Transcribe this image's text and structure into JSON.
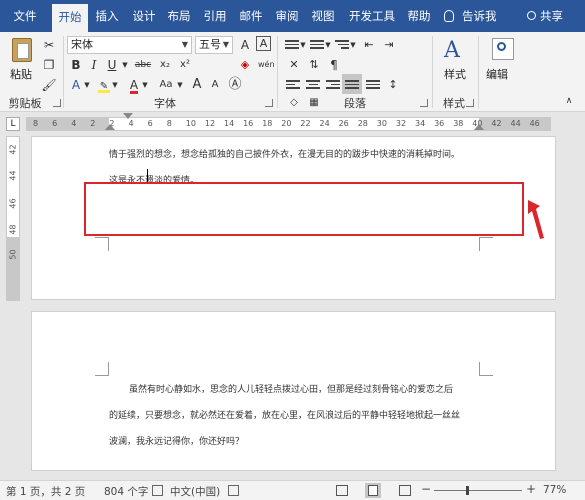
{
  "menu": {
    "tabs": [
      "文件",
      "开始",
      "插入",
      "设计",
      "布局",
      "引用",
      "邮件",
      "审阅",
      "视图",
      "开发工具",
      "帮助"
    ],
    "active": "开始",
    "tell_me": "告诉我",
    "share": "共享"
  },
  "ribbon": {
    "paste_label": "粘贴",
    "font_name": "宋体",
    "font_size": "五号",
    "groups": {
      "clipboard": "剪贴板",
      "font": "字体",
      "paragraph": "段落",
      "styles": "样式"
    },
    "styles_label": "样式",
    "edit_label": "编辑",
    "font_buttons": [
      "B",
      "I",
      "U",
      "abc",
      "x₂",
      "x²",
      "A",
      "A",
      "Aa",
      "A",
      "A"
    ],
    "grow_font": "A",
    "shrink_font": "A",
    "case": "Aa",
    "clear_format": "A",
    "wen": "wén",
    "a_box": "A"
  },
  "ruler": {
    "corner": "L",
    "ticks": [
      "8",
      "6",
      "4",
      "2",
      "2",
      "4",
      "6",
      "8",
      "10",
      "12",
      "14",
      "16",
      "18",
      "20",
      "22",
      "24",
      "26",
      "28",
      "30",
      "32",
      "34",
      "36",
      "38",
      "40",
      "42",
      "44",
      "46"
    ],
    "vticks": [
      "42",
      "44",
      "46",
      "48",
      "50"
    ]
  },
  "page1": {
    "lines": [
      "情于强烈的想念，想念给孤独的自己披件外衣，在漫无目的的跋步中快速的消耗掉时间。",
      "这是永不遗淡的爱情。"
    ]
  },
  "page2": {
    "lines": [
      "虽然有时心静如水，思念的人儿轻轻点拨过心田，但那是经过刻骨铭心的爱恋之后",
      "的延续，只要想念，就必然还在爱着，放在心里，在风浪过后的平静中轻轻地掀起一丝丝",
      "波澜，我永远记得你，你还好吗？"
    ]
  },
  "status": {
    "page": "第 1 页，共 2 页",
    "words": "804 个字",
    "lang": "中文(中国)",
    "zoom": "77%",
    "zoom_level": 77,
    "minus": "−",
    "plus": "+"
  }
}
